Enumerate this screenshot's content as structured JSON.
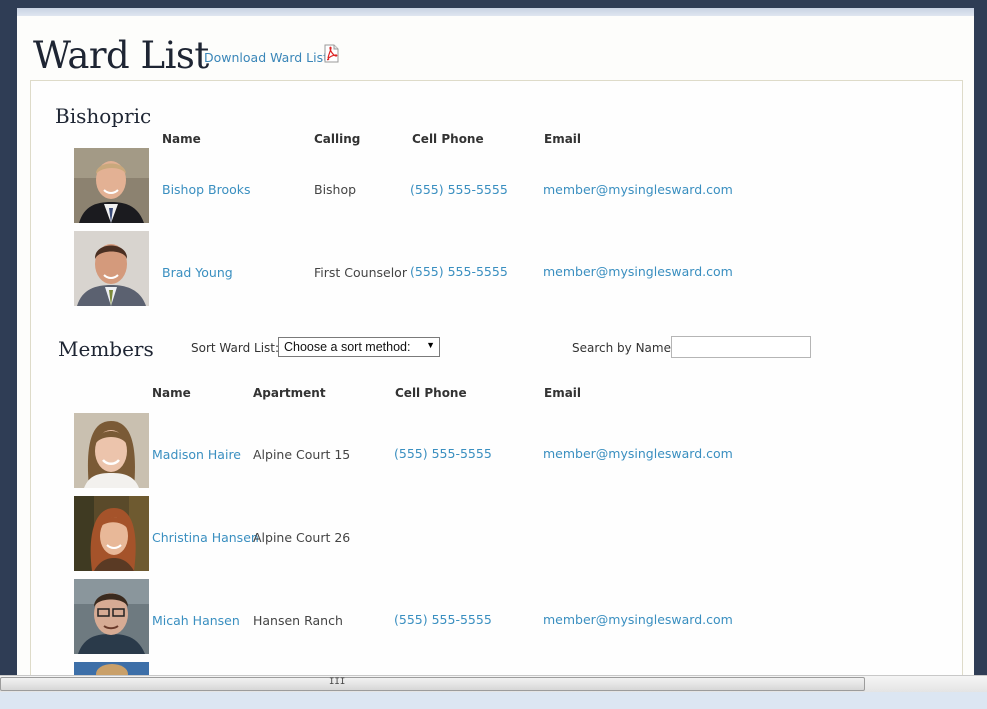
{
  "page": {
    "title": "Ward List",
    "download_label": "Download Ward List"
  },
  "bishopric": {
    "heading": "Bishopric",
    "columns": [
      "Name",
      "Calling",
      "Cell Phone",
      "Email"
    ],
    "rows": [
      {
        "name": "Bishop Brooks",
        "calling": "Bishop",
        "phone": "(555) 555-5555",
        "email": "member@mysinglesward.com"
      },
      {
        "name": "Brad Young",
        "calling": "First Counselor",
        "phone": "(555) 555-5555",
        "email": "member@mysinglesward.com"
      }
    ]
  },
  "members": {
    "heading": "Members",
    "sort_label": "Sort Ward List:",
    "sort_value": "Choose a sort method:",
    "search_label": "Search by Name:",
    "search_value": "",
    "columns": [
      "Name",
      "Apartment",
      "Cell Phone",
      "Email"
    ],
    "rows": [
      {
        "name": "Madison Haire",
        "apartment": "Alpine Court 15",
        "phone": "(555) 555-5555",
        "email": "member@mysinglesward.com"
      },
      {
        "name": "Christina Hansen",
        "apartment": "Alpine Court 26",
        "phone": "",
        "email": ""
      },
      {
        "name": "Micah Hansen",
        "apartment": "Hansen Ranch",
        "phone": "(555) 555-5555",
        "email": "member@mysinglesward.com"
      }
    ]
  },
  "scrollbar": {
    "grip": "III"
  },
  "colors": {
    "link": "#3a8fc0",
    "background": "#2f3d55",
    "page": "#fdfdfb"
  }
}
